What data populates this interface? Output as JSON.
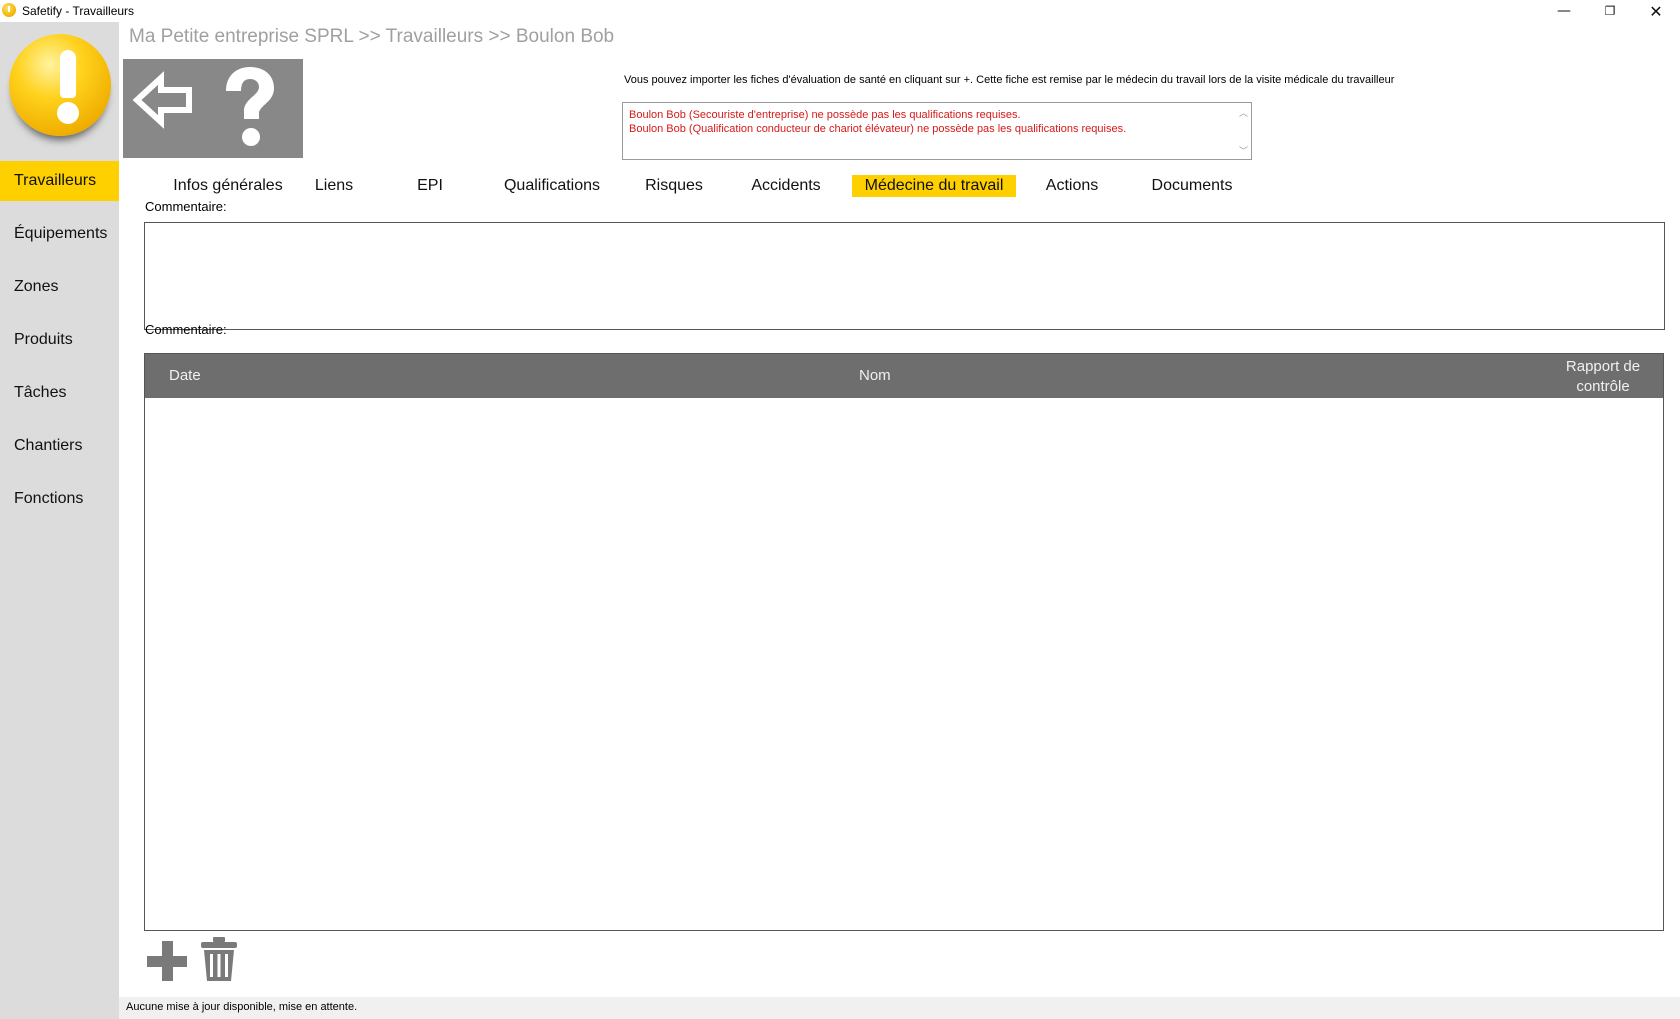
{
  "window": {
    "title": "Safetify - Travailleurs",
    "minimize_glyph": "—",
    "maximize_glyph": "❐",
    "close_glyph": "✕"
  },
  "sidebar": {
    "items": [
      {
        "label": "Travailleurs",
        "active": true
      },
      {
        "label": "Équipements",
        "active": false
      },
      {
        "label": "Zones",
        "active": false
      },
      {
        "label": "Produits",
        "active": false
      },
      {
        "label": "Tâches",
        "active": false
      },
      {
        "label": "Chantiers",
        "active": false
      },
      {
        "label": "Fonctions",
        "active": false
      }
    ]
  },
  "breadcrumb": "Ma Petite entreprise SPRL >> Travailleurs >> Boulon Bob",
  "toolbar": {
    "back_icon": "back-arrow-icon",
    "help_icon": "question-mark-icon"
  },
  "info": {
    "text": "Vous pouvez importer les fiches d'évaluation de santé en cliquant sur +. Cette fiche est remise par le médecin du travail lors de la visite médicale du travailleur",
    "warnings": [
      "Boulon Bob (Secouriste d'entreprise) ne possède pas les qualifications requises.",
      "Boulon Bob (Qualification conducteur de chariot élévateur) ne possède pas les qualifications requises."
    ]
  },
  "tabs": [
    {
      "label": "Infos générales",
      "active": false
    },
    {
      "label": "Liens",
      "active": false
    },
    {
      "label": "EPI",
      "active": false
    },
    {
      "label": "Qualifications",
      "active": false
    },
    {
      "label": "Risques",
      "active": false
    },
    {
      "label": "Accidents",
      "active": false
    },
    {
      "label": "Médecine du travail",
      "active": true
    },
    {
      "label": "Actions",
      "active": false
    },
    {
      "label": "Documents",
      "active": false
    }
  ],
  "comment1": {
    "label": "Commentaire:",
    "value": ""
  },
  "comment2": {
    "label": "Commentaire:"
  },
  "table": {
    "columns": [
      "Date",
      "Nom",
      "Rapport de contrôle"
    ],
    "rows": []
  },
  "actions": {
    "add_icon": "plus-icon",
    "delete_icon": "trash-icon"
  },
  "status": "Aucune mise à jour disponible, mise en attente.",
  "colors": {
    "accent": "#ffd000",
    "sidebar_bg": "#dcdcdc",
    "toolbar_bg": "#888888",
    "table_header_bg": "#6e6e6e",
    "warning": "#d41a1a"
  }
}
